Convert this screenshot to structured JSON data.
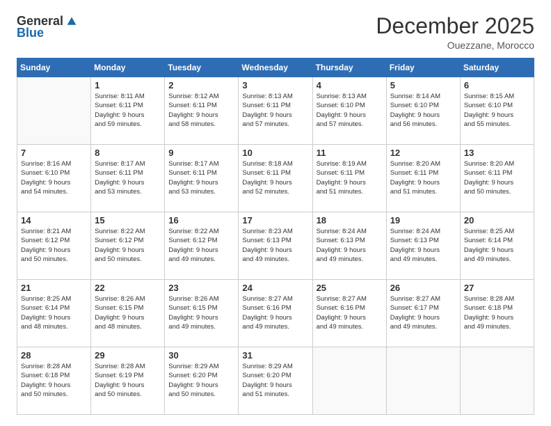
{
  "logo": {
    "general": "General",
    "blue": "Blue"
  },
  "title": "December 2025",
  "subtitle": "Ouezzane, Morocco",
  "days_header": [
    "Sunday",
    "Monday",
    "Tuesday",
    "Wednesday",
    "Thursday",
    "Friday",
    "Saturday"
  ],
  "weeks": [
    [
      {
        "num": "",
        "info": ""
      },
      {
        "num": "1",
        "info": "Sunrise: 8:11 AM\nSunset: 6:11 PM\nDaylight: 9 hours\nand 59 minutes."
      },
      {
        "num": "2",
        "info": "Sunrise: 8:12 AM\nSunset: 6:11 PM\nDaylight: 9 hours\nand 58 minutes."
      },
      {
        "num": "3",
        "info": "Sunrise: 8:13 AM\nSunset: 6:11 PM\nDaylight: 9 hours\nand 57 minutes."
      },
      {
        "num": "4",
        "info": "Sunrise: 8:13 AM\nSunset: 6:10 PM\nDaylight: 9 hours\nand 57 minutes."
      },
      {
        "num": "5",
        "info": "Sunrise: 8:14 AM\nSunset: 6:10 PM\nDaylight: 9 hours\nand 56 minutes."
      },
      {
        "num": "6",
        "info": "Sunrise: 8:15 AM\nSunset: 6:10 PM\nDaylight: 9 hours\nand 55 minutes."
      }
    ],
    [
      {
        "num": "7",
        "info": "Sunrise: 8:16 AM\nSunset: 6:10 PM\nDaylight: 9 hours\nand 54 minutes."
      },
      {
        "num": "8",
        "info": "Sunrise: 8:17 AM\nSunset: 6:11 PM\nDaylight: 9 hours\nand 53 minutes."
      },
      {
        "num": "9",
        "info": "Sunrise: 8:17 AM\nSunset: 6:11 PM\nDaylight: 9 hours\nand 53 minutes."
      },
      {
        "num": "10",
        "info": "Sunrise: 8:18 AM\nSunset: 6:11 PM\nDaylight: 9 hours\nand 52 minutes."
      },
      {
        "num": "11",
        "info": "Sunrise: 8:19 AM\nSunset: 6:11 PM\nDaylight: 9 hours\nand 51 minutes."
      },
      {
        "num": "12",
        "info": "Sunrise: 8:20 AM\nSunset: 6:11 PM\nDaylight: 9 hours\nand 51 minutes."
      },
      {
        "num": "13",
        "info": "Sunrise: 8:20 AM\nSunset: 6:11 PM\nDaylight: 9 hours\nand 50 minutes."
      }
    ],
    [
      {
        "num": "14",
        "info": "Sunrise: 8:21 AM\nSunset: 6:12 PM\nDaylight: 9 hours\nand 50 minutes."
      },
      {
        "num": "15",
        "info": "Sunrise: 8:22 AM\nSunset: 6:12 PM\nDaylight: 9 hours\nand 50 minutes."
      },
      {
        "num": "16",
        "info": "Sunrise: 8:22 AM\nSunset: 6:12 PM\nDaylight: 9 hours\nand 49 minutes."
      },
      {
        "num": "17",
        "info": "Sunrise: 8:23 AM\nSunset: 6:13 PM\nDaylight: 9 hours\nand 49 minutes."
      },
      {
        "num": "18",
        "info": "Sunrise: 8:24 AM\nSunset: 6:13 PM\nDaylight: 9 hours\nand 49 minutes."
      },
      {
        "num": "19",
        "info": "Sunrise: 8:24 AM\nSunset: 6:13 PM\nDaylight: 9 hours\nand 49 minutes."
      },
      {
        "num": "20",
        "info": "Sunrise: 8:25 AM\nSunset: 6:14 PM\nDaylight: 9 hours\nand 49 minutes."
      }
    ],
    [
      {
        "num": "21",
        "info": "Sunrise: 8:25 AM\nSunset: 6:14 PM\nDaylight: 9 hours\nand 48 minutes."
      },
      {
        "num": "22",
        "info": "Sunrise: 8:26 AM\nSunset: 6:15 PM\nDaylight: 9 hours\nand 48 minutes."
      },
      {
        "num": "23",
        "info": "Sunrise: 8:26 AM\nSunset: 6:15 PM\nDaylight: 9 hours\nand 49 minutes."
      },
      {
        "num": "24",
        "info": "Sunrise: 8:27 AM\nSunset: 6:16 PM\nDaylight: 9 hours\nand 49 minutes."
      },
      {
        "num": "25",
        "info": "Sunrise: 8:27 AM\nSunset: 6:16 PM\nDaylight: 9 hours\nand 49 minutes."
      },
      {
        "num": "26",
        "info": "Sunrise: 8:27 AM\nSunset: 6:17 PM\nDaylight: 9 hours\nand 49 minutes."
      },
      {
        "num": "27",
        "info": "Sunrise: 8:28 AM\nSunset: 6:18 PM\nDaylight: 9 hours\nand 49 minutes."
      }
    ],
    [
      {
        "num": "28",
        "info": "Sunrise: 8:28 AM\nSunset: 6:18 PM\nDaylight: 9 hours\nand 50 minutes."
      },
      {
        "num": "29",
        "info": "Sunrise: 8:28 AM\nSunset: 6:19 PM\nDaylight: 9 hours\nand 50 minutes."
      },
      {
        "num": "30",
        "info": "Sunrise: 8:29 AM\nSunset: 6:20 PM\nDaylight: 9 hours\nand 50 minutes."
      },
      {
        "num": "31",
        "info": "Sunrise: 8:29 AM\nSunset: 6:20 PM\nDaylight: 9 hours\nand 51 minutes."
      },
      {
        "num": "",
        "info": ""
      },
      {
        "num": "",
        "info": ""
      },
      {
        "num": "",
        "info": ""
      }
    ]
  ]
}
